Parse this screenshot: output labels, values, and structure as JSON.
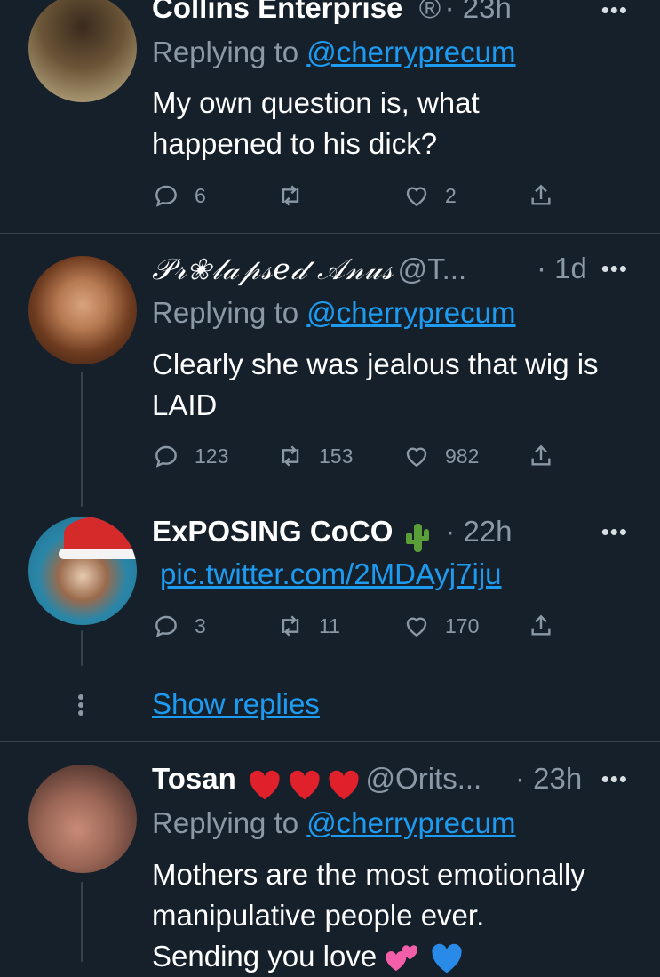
{
  "tweets": [
    {
      "name": "Collins Enterprise",
      "badge": "®",
      "time": "· 23h",
      "reply_prefix": "Replying to",
      "reply_to": "@cherryprecum",
      "text_lines": [
        "My own question is, what",
        "happened to his dick?"
      ],
      "replies": "6",
      "retweets": "",
      "likes": "2"
    },
    {
      "name": "𝒫𝓇❀𝓁𝒶𝓅𝓈𝑒𝒹 𝒜𝓃𝓊𝓈",
      "handle": "@T...",
      "time": "· 1d",
      "reply_prefix": "Replying to",
      "reply_to": "@cherryprecum",
      "text_lines": [
        "Clearly she was jealous that wig is",
        "LAID"
      ],
      "replies": "123",
      "retweets": "153",
      "likes": "982"
    },
    {
      "name": "ExPOSING CoCO",
      "name_emoji": "cactus",
      "time": "· 22h",
      "link": "pic.twitter.com/2MDAyj7iju",
      "replies": "3",
      "retweets": "11",
      "likes": "170"
    },
    {
      "name": "Tosan",
      "name_emoji": "hearts",
      "handle": "@Orits...",
      "time": "· 23h",
      "reply_prefix": "Replying to",
      "reply_to": "@cherryprecum",
      "text_lines": [
        "Mothers are the most emotionally",
        "manipulative people ever.",
        "Sending you love"
      ]
    }
  ],
  "show_replies": "Show replies",
  "more_label": "•••",
  "icons": [
    "reply-icon",
    "retweet-icon",
    "like-icon",
    "share-icon",
    "more-icon"
  ],
  "colors": {
    "background": "#15202b",
    "accent": "#1d9bf0",
    "muted": "#8b98a5",
    "divider": "#38444d"
  }
}
